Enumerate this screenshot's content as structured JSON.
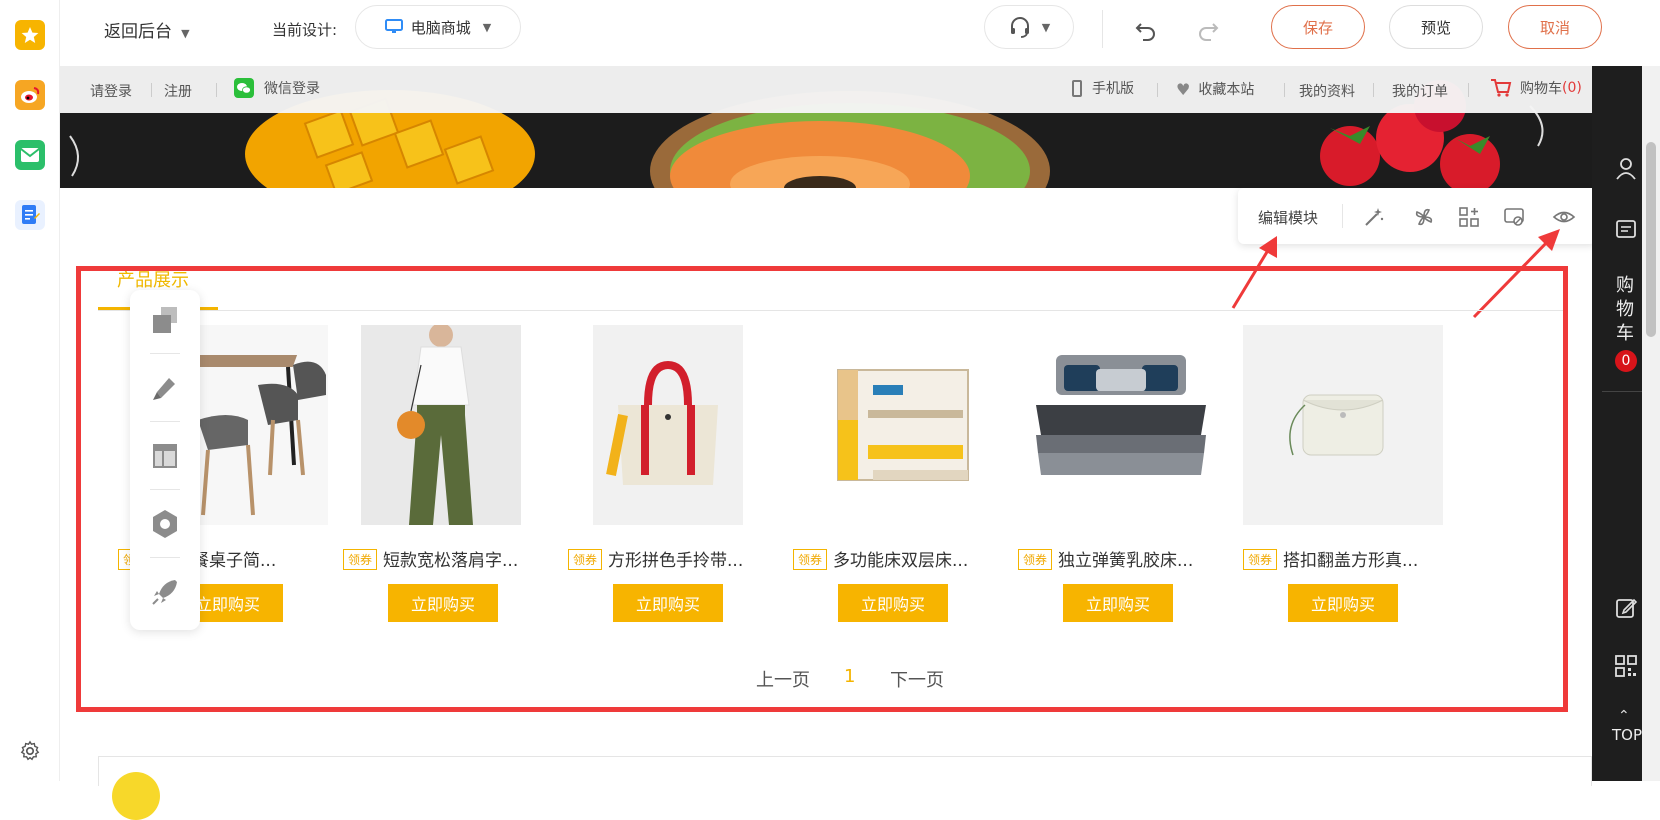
{
  "topbar": {
    "back_label": "返回后台",
    "current_design_label": "当前设计:",
    "design_name": "电脑商城",
    "save_label": "保存",
    "preview_label": "预览",
    "cancel_label": "取消"
  },
  "site_nav": {
    "login": "请登录",
    "register": "注册",
    "wechat_login": "微信登录",
    "mobile": "手机版",
    "favorite": "收藏本站",
    "my_profile": "我的资料",
    "my_orders": "我的订单",
    "cart": "购物车",
    "cart_count": "(0)"
  },
  "module_toolbar": {
    "edit_label": "编辑模块"
  },
  "module": {
    "title": "产品展示",
    "products": [
      {
        "title": "实木餐桌子简...",
        "coupon": "领券",
        "buy": "立即购买"
      },
      {
        "title": "短款宽松落肩字...",
        "coupon": "领券",
        "buy": "立即购买"
      },
      {
        "title": "方形拼色手拎带...",
        "coupon": "领券",
        "buy": "立即购买"
      },
      {
        "title": "多功能床双层床...",
        "coupon": "领券",
        "buy": "立即购买"
      },
      {
        "title": "独立弹簧乳胶床...",
        "coupon": "领券",
        "buy": "立即购买"
      },
      {
        "title": "搭扣翻盖方形真...",
        "coupon": "领券",
        "buy": "立即购买"
      }
    ],
    "pager": {
      "prev": "上一页",
      "current": "1",
      "next": "下一页"
    }
  },
  "right_bar": {
    "cart_chars": [
      "购",
      "物",
      "车"
    ],
    "cart_badge": "0",
    "top_label": "TOP"
  },
  "colors": {
    "accent": "#f7b400",
    "highlight_frame": "#ef3a3a",
    "orange_button": "#e0704a"
  }
}
